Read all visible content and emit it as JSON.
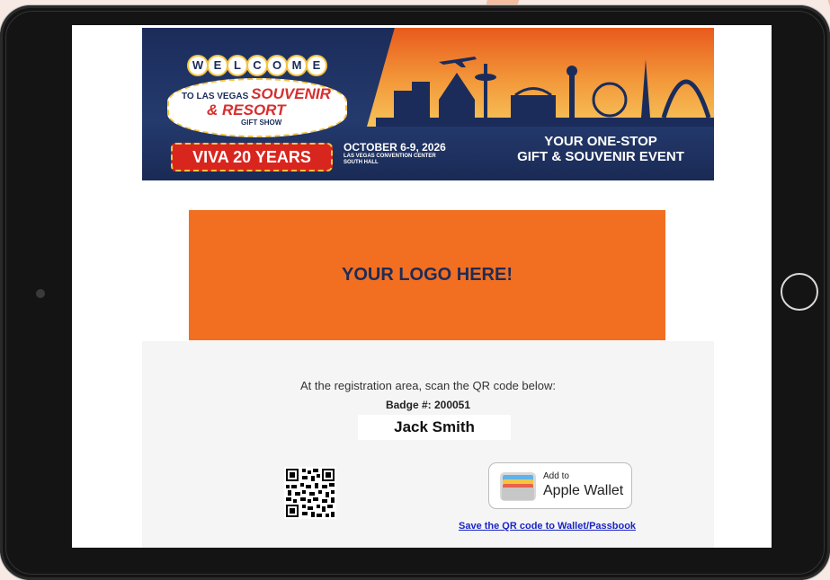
{
  "banner": {
    "welcome_letters": [
      "W",
      "E",
      "L",
      "C",
      "O",
      "M",
      "E"
    ],
    "sign_line1_prefix": "TO LAS VEGAS",
    "sign_line1_highlight": "SOUVENIR",
    "sign_line2": "& RESORT",
    "sign_line3": "GIFT SHOW",
    "viva": "VIVA 20 YEARS",
    "date": "OCTOBER 6-9, 2026",
    "venue": "LAS VEGAS CONVENTION CENTER",
    "hall": "SOUTH HALL",
    "tagline_line1": "YOUR ONE-STOP",
    "tagline_line2": "GIFT & SOUVENIR EVENT"
  },
  "logo_placeholder": "YOUR LOGO HERE!",
  "registration": {
    "instruction": "At the registration area, scan the QR code below:",
    "badge": "Badge #: 200051",
    "attendee_name": "Jack Smith"
  },
  "wallet": {
    "add_to": "Add to",
    "wallet_name": "Apple Wallet",
    "save_link": "Save the QR code to Wallet/Passbook"
  },
  "colors": {
    "accent_orange": "#f26f21",
    "banner_navy": "#1b2c5a",
    "link_blue": "#1a25c8"
  }
}
